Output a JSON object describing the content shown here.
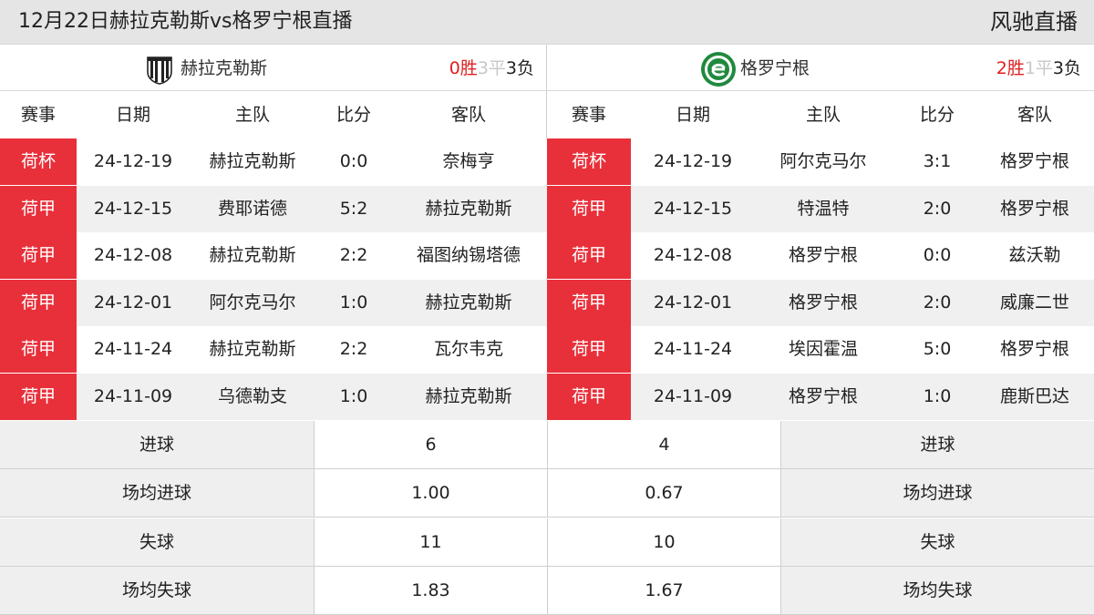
{
  "header": {
    "title": "12月22日赫拉克勒斯vs格罗宁根直播",
    "brand": "风驰直播"
  },
  "colors": {
    "competition_badge": "#e8303a",
    "win": "#e02020",
    "draw": "#c8c8c8"
  },
  "columns": {
    "competition": "赛事",
    "date": "日期",
    "home": "主队",
    "score": "比分",
    "away": "客队"
  },
  "left": {
    "team": "赫拉克勒斯",
    "logo_icon": "heracles-crest-icon",
    "record": {
      "wins": "0胜",
      "draws": "3平",
      "losses": "3负"
    },
    "matches": [
      {
        "comp": "荷杯",
        "date": "24-12-19",
        "home": "赫拉克勒斯",
        "score": "0:0",
        "away": "奈梅亨"
      },
      {
        "comp": "荷甲",
        "date": "24-12-15",
        "home": "费耶诺德",
        "score": "5:2",
        "away": "赫拉克勒斯"
      },
      {
        "comp": "荷甲",
        "date": "24-12-08",
        "home": "赫拉克勒斯",
        "score": "2:2",
        "away": "福图纳锡塔德"
      },
      {
        "comp": "荷甲",
        "date": "24-12-01",
        "home": "阿尔克马尔",
        "score": "1:0",
        "away": "赫拉克勒斯"
      },
      {
        "comp": "荷甲",
        "date": "24-11-24",
        "home": "赫拉克勒斯",
        "score": "2:2",
        "away": "瓦尔韦克"
      },
      {
        "comp": "荷甲",
        "date": "24-11-09",
        "home": "乌德勒支",
        "score": "1:0",
        "away": "赫拉克勒斯"
      }
    ]
  },
  "right": {
    "team": "格罗宁根",
    "logo_icon": "groningen-crest-icon",
    "record": {
      "wins": "2胜",
      "draws": "1平",
      "losses": "3负"
    },
    "matches": [
      {
        "comp": "荷杯",
        "date": "24-12-19",
        "home": "阿尔克马尔",
        "score": "3:1",
        "away": "格罗宁根"
      },
      {
        "comp": "荷甲",
        "date": "24-12-15",
        "home": "特温特",
        "score": "2:0",
        "away": "格罗宁根"
      },
      {
        "comp": "荷甲",
        "date": "24-12-08",
        "home": "格罗宁根",
        "score": "0:0",
        "away": "兹沃勒"
      },
      {
        "comp": "荷甲",
        "date": "24-12-01",
        "home": "格罗宁根",
        "score": "2:0",
        "away": "威廉二世"
      },
      {
        "comp": "荷甲",
        "date": "24-11-24",
        "home": "埃因霍温",
        "score": "5:0",
        "away": "格罗宁根"
      },
      {
        "comp": "荷甲",
        "date": "24-11-09",
        "home": "格罗宁根",
        "score": "1:0",
        "away": "鹿斯巴达"
      }
    ]
  },
  "stats": [
    {
      "label": "进球",
      "left": "6",
      "right": "4"
    },
    {
      "label": "场均进球",
      "left": "1.00",
      "right": "0.67"
    },
    {
      "label": "失球",
      "left": "11",
      "right": "10"
    },
    {
      "label": "场均失球",
      "left": "1.83",
      "right": "1.67"
    }
  ]
}
